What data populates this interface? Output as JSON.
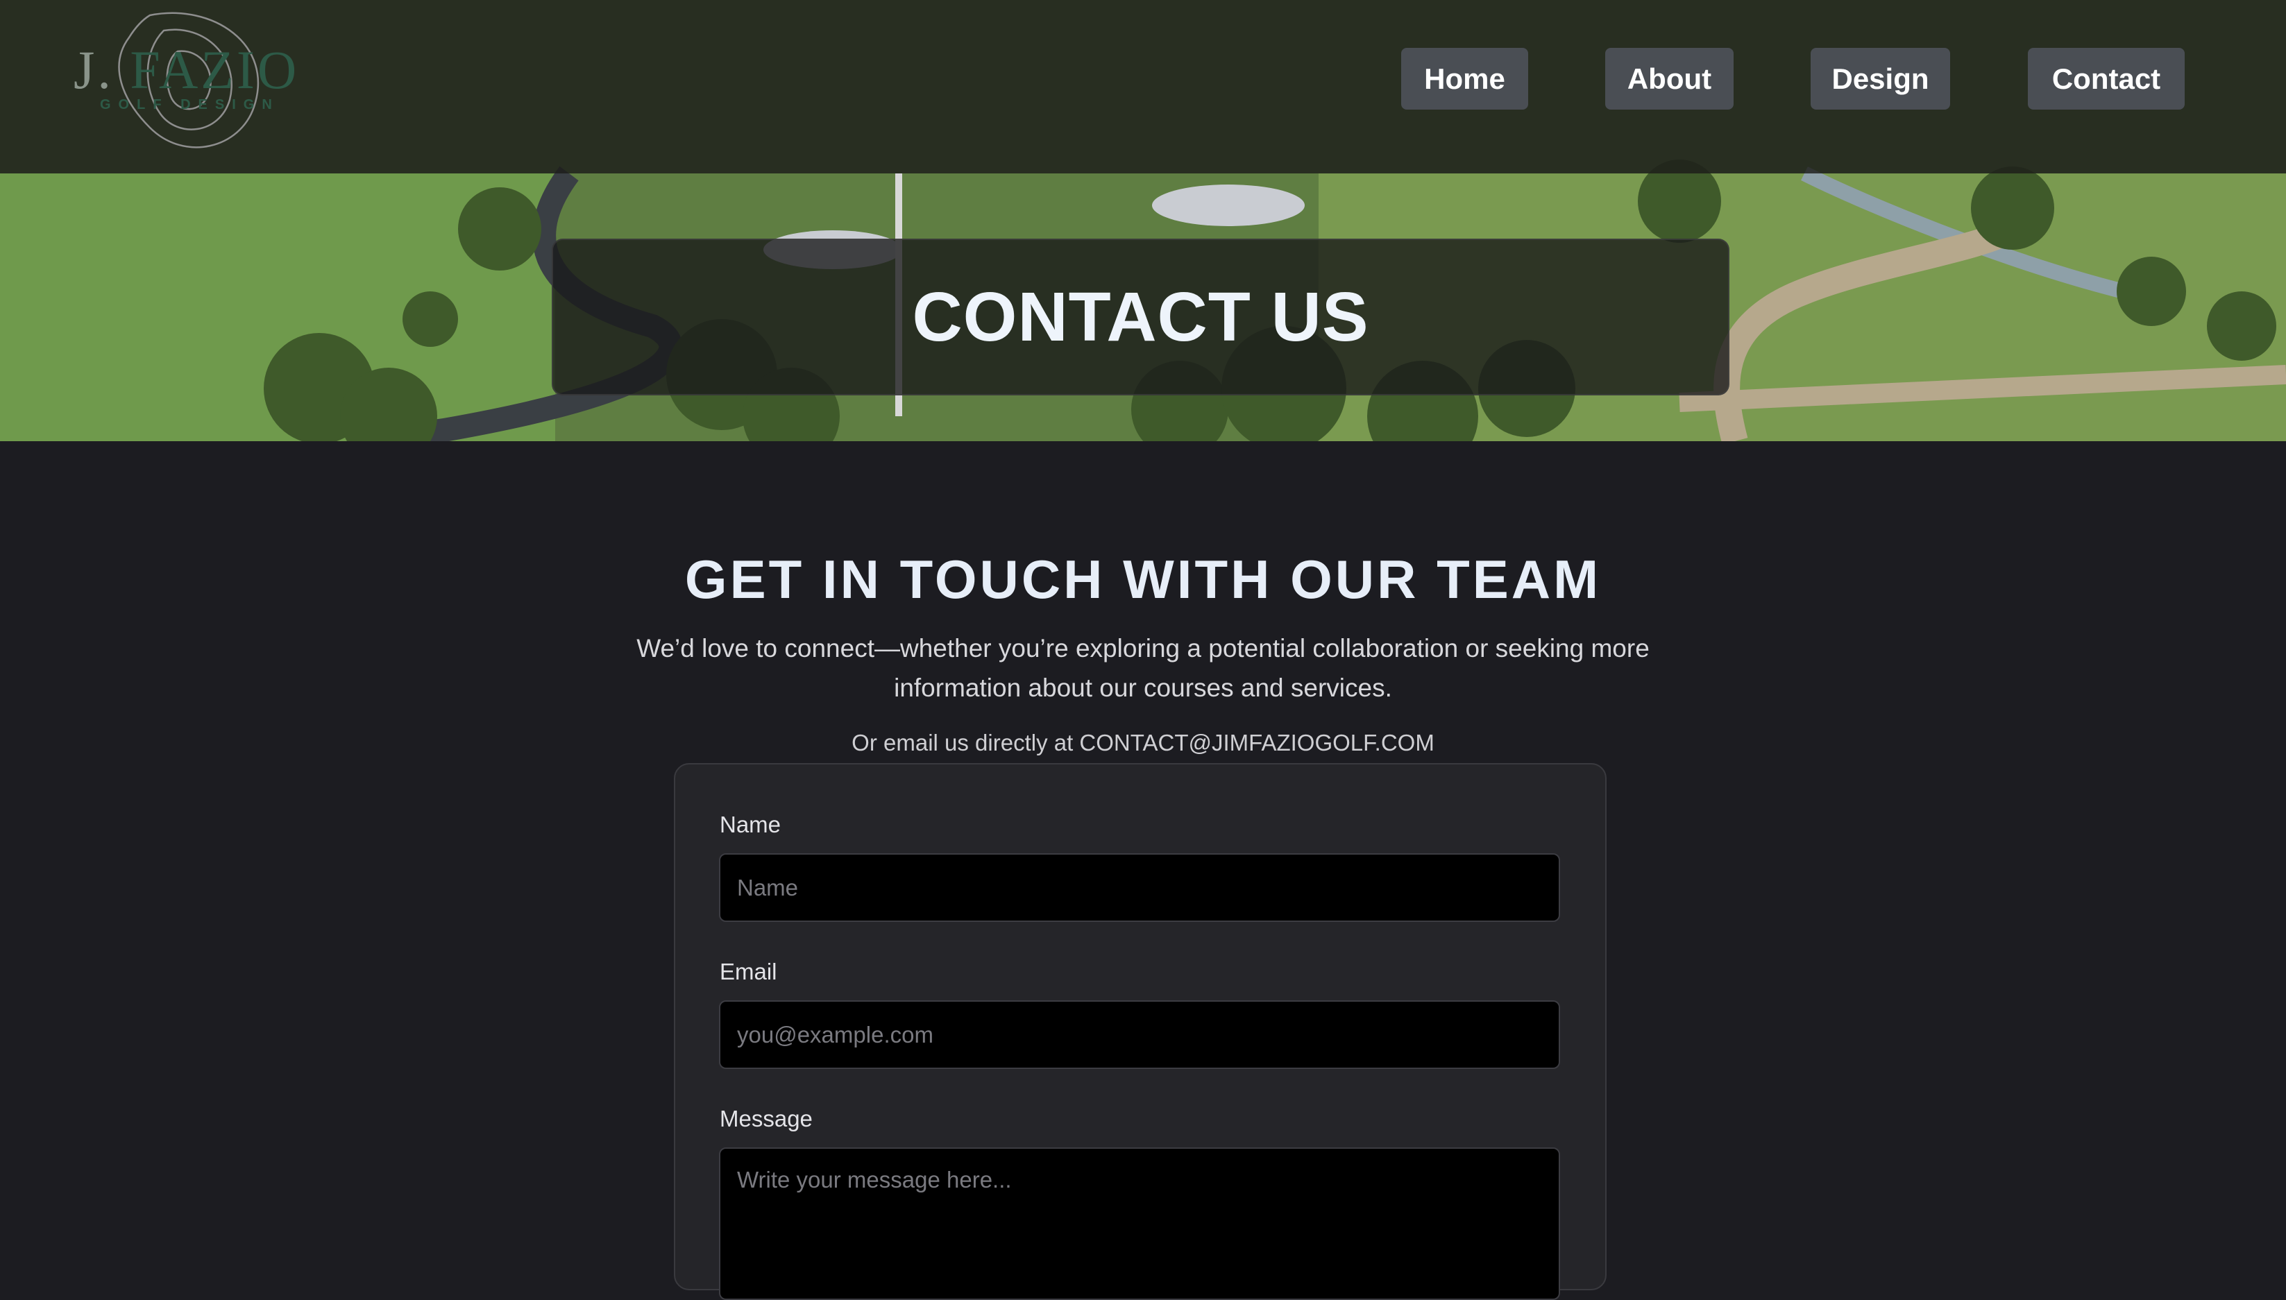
{
  "brand": {
    "initial": "J.",
    "name": "FAZIO",
    "tagline": "GOLF DESIGN"
  },
  "nav": {
    "home": "Home",
    "about": "About",
    "design": "Design",
    "contact": "Contact"
  },
  "hero": {
    "title": "CONTACT US"
  },
  "intro": {
    "heading": "GET IN TOUCH WITH OUR TEAM",
    "text": "We’d love to connect—whether you’re exploring a potential collaboration or seeking more information about our courses and services.",
    "email_line": "Or email us directly at CONTACT@JIMFAZIOGOLF.COM"
  },
  "form": {
    "name_label": "Name",
    "name_placeholder": "Name",
    "email_label": "Email",
    "email_placeholder": "you@example.com",
    "message_label": "Message",
    "message_placeholder": "Write your message here..."
  },
  "colors": {
    "page_background": "#1c1c21",
    "nav_button": "#4a4e54",
    "heading": "#e7eef8",
    "logo_accent": "#2d5a47"
  }
}
